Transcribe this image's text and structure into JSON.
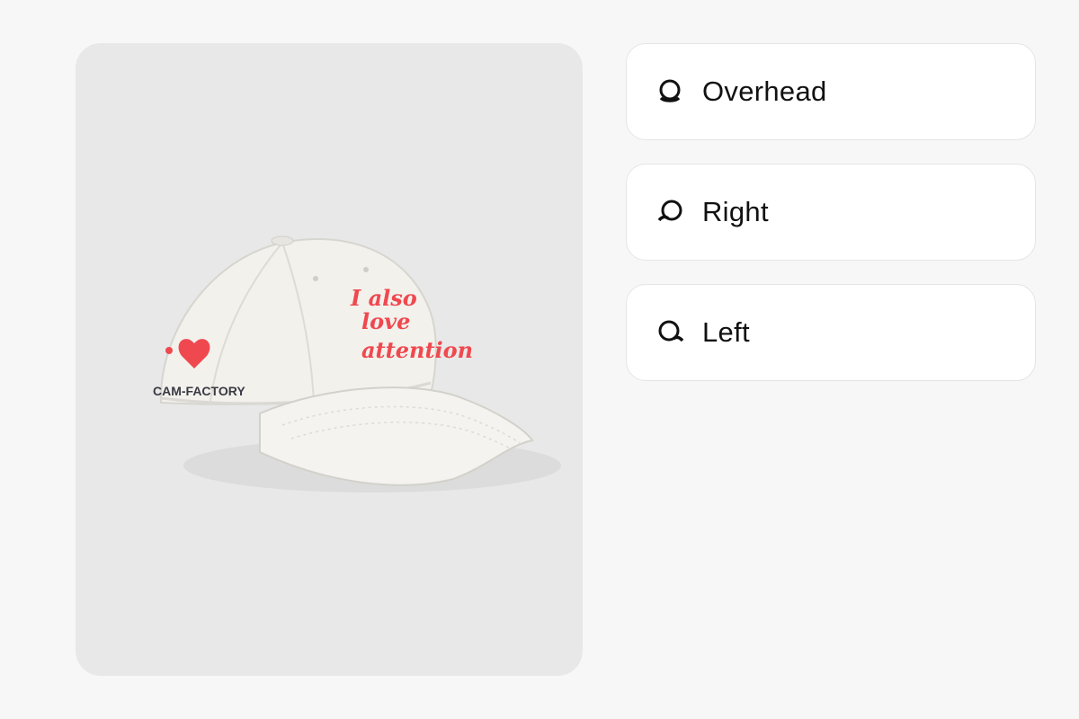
{
  "product": {
    "image_alt": "White cap",
    "brand_text": "CAM-FACTORY",
    "slogan_lines": [
      "I also",
      "love",
      "attention"
    ]
  },
  "view_options": [
    {
      "label": "Overhead",
      "icon": "overhead-view-icon"
    },
    {
      "label": "Right",
      "icon": "right-view-icon"
    },
    {
      "label": "Left",
      "icon": "left-view-icon"
    }
  ],
  "colors": {
    "page_bg": "#f7f7f7",
    "preview_bg": "#e8e8e8",
    "cap": "#f1f0ea",
    "embroidery_red": "#f0484f",
    "brand_dark": "#3a3a44"
  }
}
